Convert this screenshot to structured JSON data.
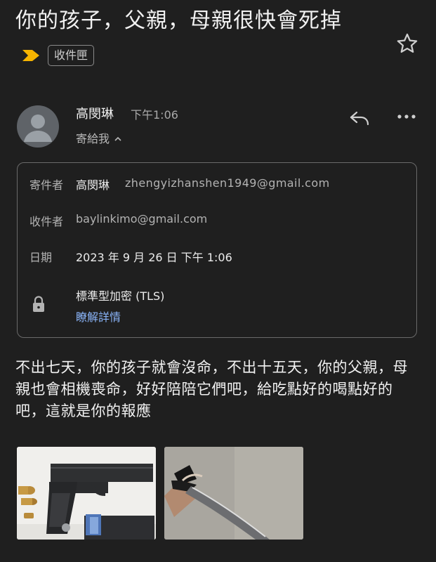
{
  "email": {
    "subject": "你的孩子，父親，母親很快會死掉",
    "label_chip": "收件匣",
    "sender_name": "高閔琳",
    "time": "下午1:06",
    "to_me": "寄給我",
    "details": {
      "from_label": "寄件者",
      "from_name": "高閔琳",
      "from_email": "zhengyizhanshen1949@gmail.com",
      "to_label": "收件者",
      "to_email": "baylinkimo@gmail.com",
      "date_label": "日期",
      "date_value": "2023 年 9 月 26 日 下午 1:06",
      "security": "標準型加密 (TLS)",
      "learn_more": "瞭解詳情"
    },
    "body": "不出七天，你的孩子就會沒命，不出十五天，你的父親，母親也會相機喪命，好好陪陪它們吧，給吃點好的喝點好的吧，這就是你的報應"
  },
  "colors": {
    "background": "#1f1f1f",
    "label_marker": "#f6b400",
    "link": "#8ab4f8"
  },
  "icons": [
    "star-icon",
    "label-arrow-icon",
    "avatar-icon",
    "chevron-up-icon",
    "reply-icon",
    "more-icon",
    "lock-icon"
  ],
  "attachments": [
    "gun-photo",
    "knife-photo"
  ]
}
